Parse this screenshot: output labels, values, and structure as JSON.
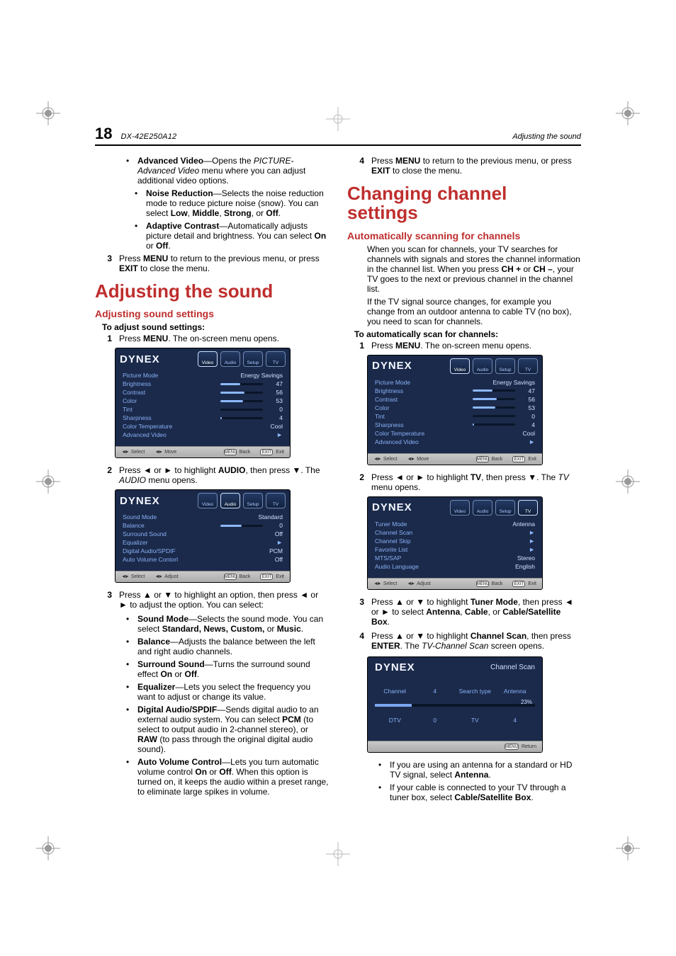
{
  "header": {
    "page_number": "18",
    "model": "DX-42E250A12",
    "title": "Adjusting the sound"
  },
  "left": {
    "adv_video_lead": "Advanced Video",
    "adv_video_tail": "—Opens the ",
    "adv_video_ital": "PICTURE-Advanced Video",
    "adv_video_end": " menu where you can adjust additional video options.",
    "nr_lead": "Noise Reduction",
    "nr_tail": "—Selects the noise reduction mode to reduce picture noise (snow). You can select ",
    "nr_b1": "Low",
    "nr_c1": ", ",
    "nr_b2": "Middle",
    "nr_c2": ", ",
    "nr_b3": "Strong",
    "nr_c3": ", or ",
    "nr_b4": "Off",
    "nr_c4": ".",
    "ac_lead": "Adaptive Contrast",
    "ac_tail": "—Automatically adjusts picture detail and brightness. You can select ",
    "ac_b1": "On",
    "ac_c1": " or ",
    "ac_b2": "Off",
    "ac_c2": ".",
    "step3_num": "3",
    "step3_a": "Press ",
    "step3_b": "MENU",
    "step3_c": " to return to the previous menu, or press ",
    "step3_d": "EXIT",
    "step3_e": " to close the menu.",
    "h1": "Adjusting the sound",
    "h2": "Adjusting sound settings",
    "legend": "To adjust sound settings:",
    "s1_num": "1",
    "s1_a": "Press ",
    "s1_b": "MENU",
    "s1_c": ". The on-screen menu opens.",
    "osd1": {
      "brand": "DYNEX",
      "tabs": [
        "Video",
        "Audio",
        "Setup",
        "TV"
      ],
      "rows": [
        {
          "k": "Picture Mode",
          "v": "Energy Savings"
        },
        {
          "k": "Brightness",
          "bar": 47,
          "v": "47"
        },
        {
          "k": "Contrast",
          "bar": 56,
          "v": "56"
        },
        {
          "k": "Color",
          "bar": 53,
          "v": "53"
        },
        {
          "k": "Tint",
          "bar": 0,
          "v": "0"
        },
        {
          "k": "Sharpness",
          "bar": 4,
          "v": "4"
        },
        {
          "k": "Color Temperature",
          "v": "Cool"
        },
        {
          "k": "Advanced Video",
          "arrow": true
        }
      ],
      "footer": {
        "select": "Select",
        "move": "Move",
        "back": "Back",
        "exit": "Exit",
        "menu": "MENU",
        "exitbtn": "EXIT"
      }
    },
    "s2_num": "2",
    "s2_pre": "Press ◄ or ► to highlight ",
    "s2_b": "AUDIO",
    "s2_mid": ", then press ▼. The ",
    "s2_i": "AUDIO",
    "s2_end": " menu opens.",
    "osd2": {
      "brand": "DYNEX",
      "tabs": [
        "Video",
        "Audio",
        "Setup",
        "TV"
      ],
      "rows": [
        {
          "k": "Sound Mode",
          "v": "Standard"
        },
        {
          "k": "Balance",
          "bar": 50,
          "v": "0"
        },
        {
          "k": "Surround Sound",
          "v": "Off"
        },
        {
          "k": "Equalizer",
          "arrow": true
        },
        {
          "k": "Digital Audio/SPDIF",
          "v": "PCM"
        },
        {
          "k": "Auto Volume Contorl",
          "v": "Off"
        }
      ],
      "footer": {
        "select": "Select",
        "move": "Adjust",
        "back": "Back",
        "exit": "Exit",
        "menu": "MENU",
        "exitbtn": "EXIT"
      }
    },
    "s3_num": "3",
    "s3_text": "Press ▲ or ▼ to highlight an option, then press ◄ or ► to adjust the option. You can select:",
    "opt_sm_l": "Sound Mode",
    "opt_sm_t": "—Selects the sound mode. You can select ",
    "opt_sm_b": "Standard, News, Custom,",
    "opt_sm_or": " or ",
    "opt_sm_b2": "Music",
    "opt_sm_p": ".",
    "opt_bal_l": "Balance",
    "opt_bal_t": "—Adjusts the balance between the left and right audio channels.",
    "opt_ss_l": "Surround Sound",
    "opt_ss_t": "—Turns the surround sound effect ",
    "opt_ss_b1": "On",
    "opt_ss_or": " or ",
    "opt_ss_b2": "Off",
    "opt_ss_p": ".",
    "opt_eq_l": "Equalizer",
    "opt_eq_t": "—Lets you select the frequency you want to adjust or change its value.",
    "opt_da_l": "Digital Audio/SPDIF",
    "opt_da_t": "—Sends digital audio to an external audio system. You can select ",
    "opt_da_b1": "PCM",
    "opt_da_m": " (to select to output audio in 2-channel stereo), or ",
    "opt_da_b2": "RAW",
    "opt_da_e": " (to pass through the original digital audio sound).",
    "opt_av_l": "Auto Volume Control",
    "opt_av_t": "—Lets you turn automatic volume control ",
    "opt_av_b1": "On",
    "opt_av_or": " or ",
    "opt_av_b2": "Off",
    "opt_av_e": ". When this option is turned on, it keeps the audio within a preset range, to eliminate large spikes in volume."
  },
  "right": {
    "s4_num": "4",
    "s4_a": "Press ",
    "s4_b": "MENU",
    "s4_c": " to return to the previous menu, or press ",
    "s4_d": "EXIT",
    "s4_e": " to close the menu.",
    "h1": "Changing channel settings",
    "h2": "Automatically scanning for channels",
    "p1_a": "When you scan for channels, your TV searches for channels with signals and stores the channel information in the channel list. When you press ",
    "p1_b": "CH +",
    "p1_c": " or ",
    "p1_d": "CH –",
    "p1_e": ", your TV goes to the next or previous channel in the channel list.",
    "p2": "If the TV signal source changes, for example you change from an outdoor antenna to cable TV (no box), you need to scan for channels.",
    "legend": "To automatically scan for channels:",
    "r1_num": "1",
    "r1_a": "Press ",
    "r1_b": "MENU",
    "r1_c": ". The on-screen menu opens.",
    "osd1": {
      "brand": "DYNEX",
      "tabs": [
        "Video",
        "Audio",
        "Setup",
        "TV"
      ],
      "rows": [
        {
          "k": "Picture Mode",
          "v": "Energy Savings"
        },
        {
          "k": "Brightness",
          "bar": 47,
          "v": "47"
        },
        {
          "k": "Contrast",
          "bar": 56,
          "v": "56"
        },
        {
          "k": "Color",
          "bar": 53,
          "v": "53"
        },
        {
          "k": "Tint",
          "bar": 0,
          "v": "0"
        },
        {
          "k": "Sharpness",
          "bar": 4,
          "v": "4"
        },
        {
          "k": "Color Temperature",
          "v": "Cool"
        },
        {
          "k": "Advanced Video",
          "arrow": true
        }
      ],
      "footer": {
        "select": "Select",
        "move": "Move",
        "back": "Back",
        "exit": "Exit",
        "menu": "MENU",
        "exitbtn": "EXIT"
      }
    },
    "r2_num": "2",
    "r2_pre": "Press ◄ or ► to highlight ",
    "r2_b": "TV",
    "r2_mid": ", then press ▼. The ",
    "r2_i": "TV",
    "r2_end": " menu opens.",
    "osd2": {
      "brand": "DYNEX",
      "tabs": [
        "Video",
        "Audio",
        "Setup",
        "TV"
      ],
      "rows": [
        {
          "k": "Tuner Mode",
          "v": "Antenna"
        },
        {
          "k": "Channel Scan",
          "arrow": true
        },
        {
          "k": "Channel Skip",
          "arrow": true
        },
        {
          "k": "Favorite List",
          "arrow": true
        },
        {
          "k": "MTS/SAP",
          "v": "Stereo"
        },
        {
          "k": "Audio Language",
          "v": "English"
        }
      ],
      "footer": {
        "select": "Select",
        "move": "Adjust",
        "back": "Back",
        "exit": "Exit",
        "menu": "MENU",
        "exitbtn": "EXIT"
      }
    },
    "r3_num": "3",
    "r3_pre": "Press ▲ or ▼ to highlight ",
    "r3_b": "Tuner Mode",
    "r3_mid": ", then press ◄ or ► to select ",
    "r3_b1": "Antenna",
    "r3_c1": ", ",
    "r3_b2": "Cable",
    "r3_c2": ", or ",
    "r3_b3": "Cable/Satellite Box",
    "r3_c3": ".",
    "r4_num": "4",
    "r4_pre": "Press ▲ or ▼ to highlight ",
    "r4_b": "Channel Scan",
    "r4_mid": ", then press ",
    "r4_b2": "ENTER",
    "r4_mid2": ". The ",
    "r4_i": "TV-Channel Scan",
    "r4_end": " screen opens.",
    "scan": {
      "brand": "DYNEX",
      "title": "Channel Scan",
      "rows": [
        [
          "Channel",
          "4",
          "Search type",
          "Antenna"
        ],
        [
          "DTV",
          "0",
          "TV",
          "4"
        ]
      ],
      "pct": "23%",
      "pctval": 23,
      "return": "Return",
      "menu": "MENU"
    },
    "b1_a": "If you are using an antenna for a standard or HD TV signal, select ",
    "b1_b": "Antenna",
    "b1_c": ".",
    "b2_a": "If your cable is connected to your TV through a tuner box, select ",
    "b2_b": "Cable/Satellite Box",
    "b2_c": "."
  }
}
